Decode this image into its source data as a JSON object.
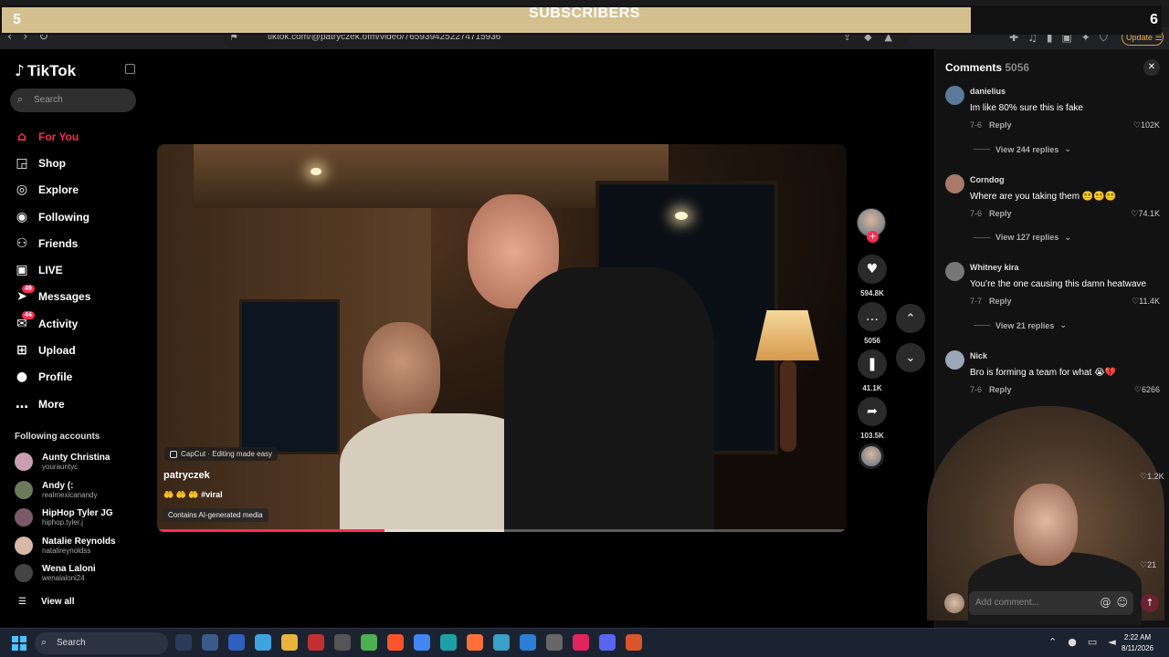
{
  "overlay": {
    "left_number": "5",
    "title": "SUBSCRIBERS",
    "right_number": "6"
  },
  "browser": {
    "url": "tiktok.com/@patryczek.ofm/video/7659394252274715936",
    "update_label": "Update"
  },
  "sidebar": {
    "logo": "TikTok",
    "search_placeholder": "Search",
    "nav": [
      {
        "label": "For You",
        "icon": "home-icon"
      },
      {
        "label": "Shop",
        "icon": "shop-bag-icon"
      },
      {
        "label": "Explore",
        "icon": "compass-icon"
      },
      {
        "label": "Following",
        "icon": "following-avatar-icon"
      },
      {
        "label": "Friends",
        "icon": "friends-icon"
      },
      {
        "label": "LIVE",
        "icon": "live-tv-icon"
      },
      {
        "label": "Messages",
        "icon": "send-icon",
        "badge": "49"
      },
      {
        "label": "Activity",
        "icon": "inbox-icon",
        "badge": "44"
      },
      {
        "label": "Upload",
        "icon": "plus-square-icon"
      },
      {
        "label": "Profile",
        "icon": "profile-avatar-icon"
      },
      {
        "label": "More",
        "icon": "more-dots-icon"
      }
    ],
    "following_heading": "Following accounts",
    "accounts": [
      {
        "name": "Aunty Christina",
        "handle": "yourauntyc"
      },
      {
        "name": "Andy (:",
        "handle": "realmexicanandy"
      },
      {
        "name": "HipHop Tyler JG",
        "handle": "hiphop.tyler.j"
      },
      {
        "name": "Natalie Reynolds",
        "handle": "natalireynoldss"
      },
      {
        "name": "Wena Laloni",
        "handle": "wenalaloni24"
      }
    ],
    "view_all": "View all"
  },
  "video": {
    "capcut_label": "CapCut · Editing made easy",
    "author": "patryczek",
    "caption": "#viral",
    "ai_label": "Contains AI-generated media",
    "progress": 0.33
  },
  "actions": {
    "likes": "594.8K",
    "comments": "5056",
    "saves": "41.1K",
    "shares": "103.5K"
  },
  "comments_panel": {
    "title": "Comments",
    "count": "5056",
    "items": [
      {
        "user": "danielius",
        "text": "Im like 80% sure this is fake",
        "date": "7-6",
        "reply": "Reply",
        "likes": "102K",
        "replies": "View 244 replies"
      },
      {
        "user": "Corndog",
        "text": "Where are you taking them 😵‍💫😵‍💫😵‍💫",
        "date": "7-6",
        "reply": "Reply",
        "likes": "74.1K",
        "replies": "View 127 replies"
      },
      {
        "user": "Whitney kira",
        "text": "You’re the one causing this damn heatwave",
        "date": "7-7",
        "reply": "Reply",
        "likes": "11.4K",
        "replies": "View 21 replies"
      },
      {
        "user": "Nick",
        "text": "Bro is forming a team for what 😭💔",
        "date": "7-6",
        "reply": "Reply",
        "likes": "6266",
        "replies": ""
      }
    ],
    "partial_like_1": "1.2K",
    "partial_like_2": "21",
    "input_placeholder": "Add comment..."
  },
  "taskbar": {
    "search_label": "Search",
    "time": "2:22 AM",
    "date": "8/11/2026"
  }
}
